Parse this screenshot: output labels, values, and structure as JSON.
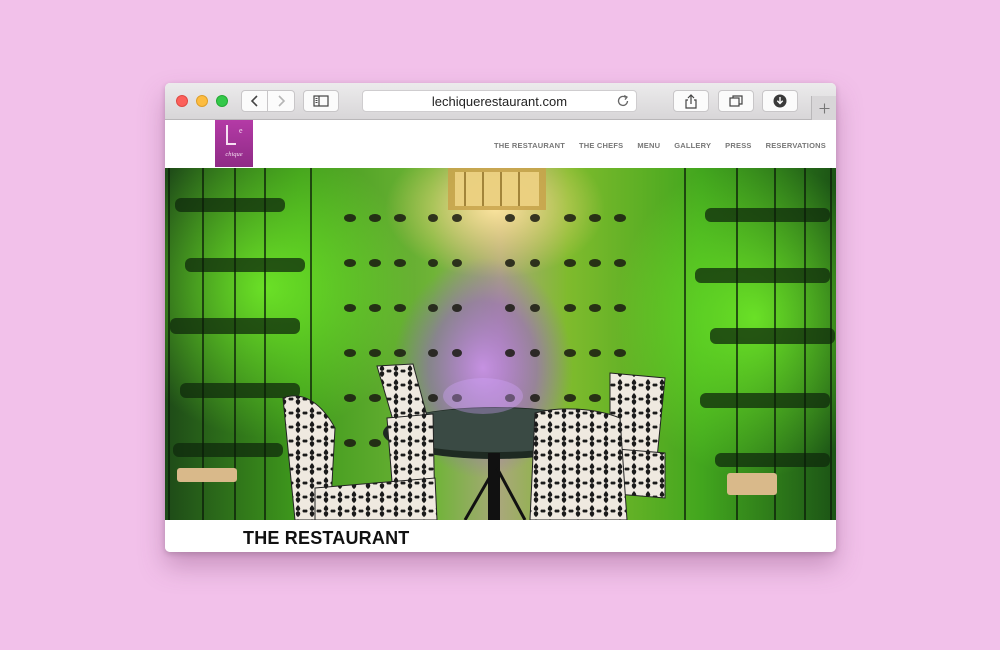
{
  "browser": {
    "url": "lechiquerestaurant.com",
    "back_icon": "chevron-left-icon",
    "forward_icon": "chevron-right-icon",
    "sidebar_icon": "sidebar-icon",
    "share_icon": "share-icon",
    "tabs_icon": "tabs-overview-icon",
    "download_icon": "download-icon",
    "reload_icon": "reload-icon",
    "newtab_icon": "plus-icon"
  },
  "site": {
    "logo": {
      "text": "chique",
      "color": "#a8349b"
    },
    "nav": [
      {
        "label": "THE RESTAURANT"
      },
      {
        "label": "THE CHEFS"
      },
      {
        "label": "MENU"
      },
      {
        "label": "GALLERY"
      },
      {
        "label": "PRESS"
      },
      {
        "label": "RESERVATIONS"
      }
    ],
    "section_title": "THE RESTAURANT"
  },
  "colors": {
    "background": "#f2c1ea",
    "accent": "#a8349b"
  }
}
